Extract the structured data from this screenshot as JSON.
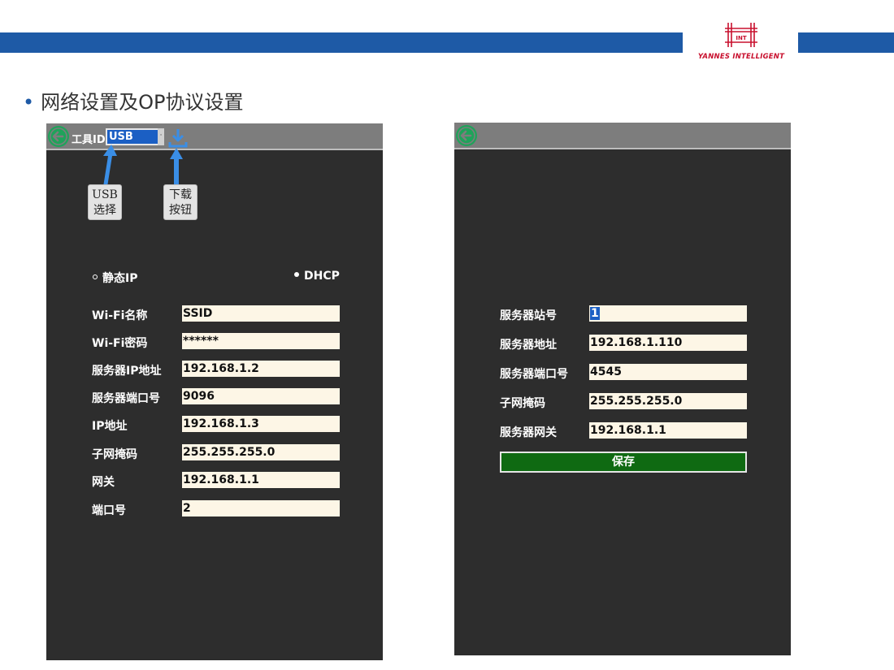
{
  "header": {
    "logo_text": "YANNES INTELLIGENT",
    "logo_mark_text": "INT"
  },
  "slide": {
    "bullet": "•",
    "title": "网络设置及OP协议设置"
  },
  "left_screen": {
    "tool_id_label": "工具ID",
    "usb_select_value": "USB",
    "dropdown_glyph": "·",
    "callouts": {
      "usb": "USB\n选择",
      "download": "下载\n按钮"
    },
    "radios": [
      {
        "label": "静态IP",
        "selected": false
      },
      {
        "label": "DHCP",
        "selected": true
      }
    ],
    "fields": [
      {
        "label": "Wi-Fi名称",
        "value": "SSID"
      },
      {
        "label": "Wi-Fi密码",
        "value": "******"
      },
      {
        "label": "服务器IP地址",
        "value": "192.168.1.2"
      },
      {
        "label": "服务器端口号",
        "value": "9096"
      },
      {
        "label": "IP地址",
        "value": "192.168.1.3"
      },
      {
        "label": "子网掩码",
        "value": "255.255.255.0"
      },
      {
        "label": "网关",
        "value": "192.168.1.1"
      },
      {
        "label": "端口号",
        "value": "2"
      }
    ]
  },
  "right_screen": {
    "fields": [
      {
        "label": "服务器站号",
        "value": "1"
      },
      {
        "label": "服务器地址",
        "value": "192.168.1.110"
      },
      {
        "label": "服务器端口号",
        "value": "4545"
      },
      {
        "label": "子网掩码",
        "value": "255.255.255.0"
      },
      {
        "label": "服务器网关",
        "value": "192.168.1.1"
      }
    ],
    "save_label": "保存"
  },
  "colors": {
    "header_bar": "#1e5aa6",
    "screen_bg": "#2d2d2d",
    "topbar_bg": "#7d7d7d",
    "field_bg": "#fdf6e6",
    "save_bg": "#0f6a12",
    "back_icon": "#1fa35a",
    "accent_blue": "#3a8ee6",
    "logo_red": "#c8102e"
  },
  "icons": {
    "back": "back-arrow-icon",
    "download": "download-icon"
  }
}
